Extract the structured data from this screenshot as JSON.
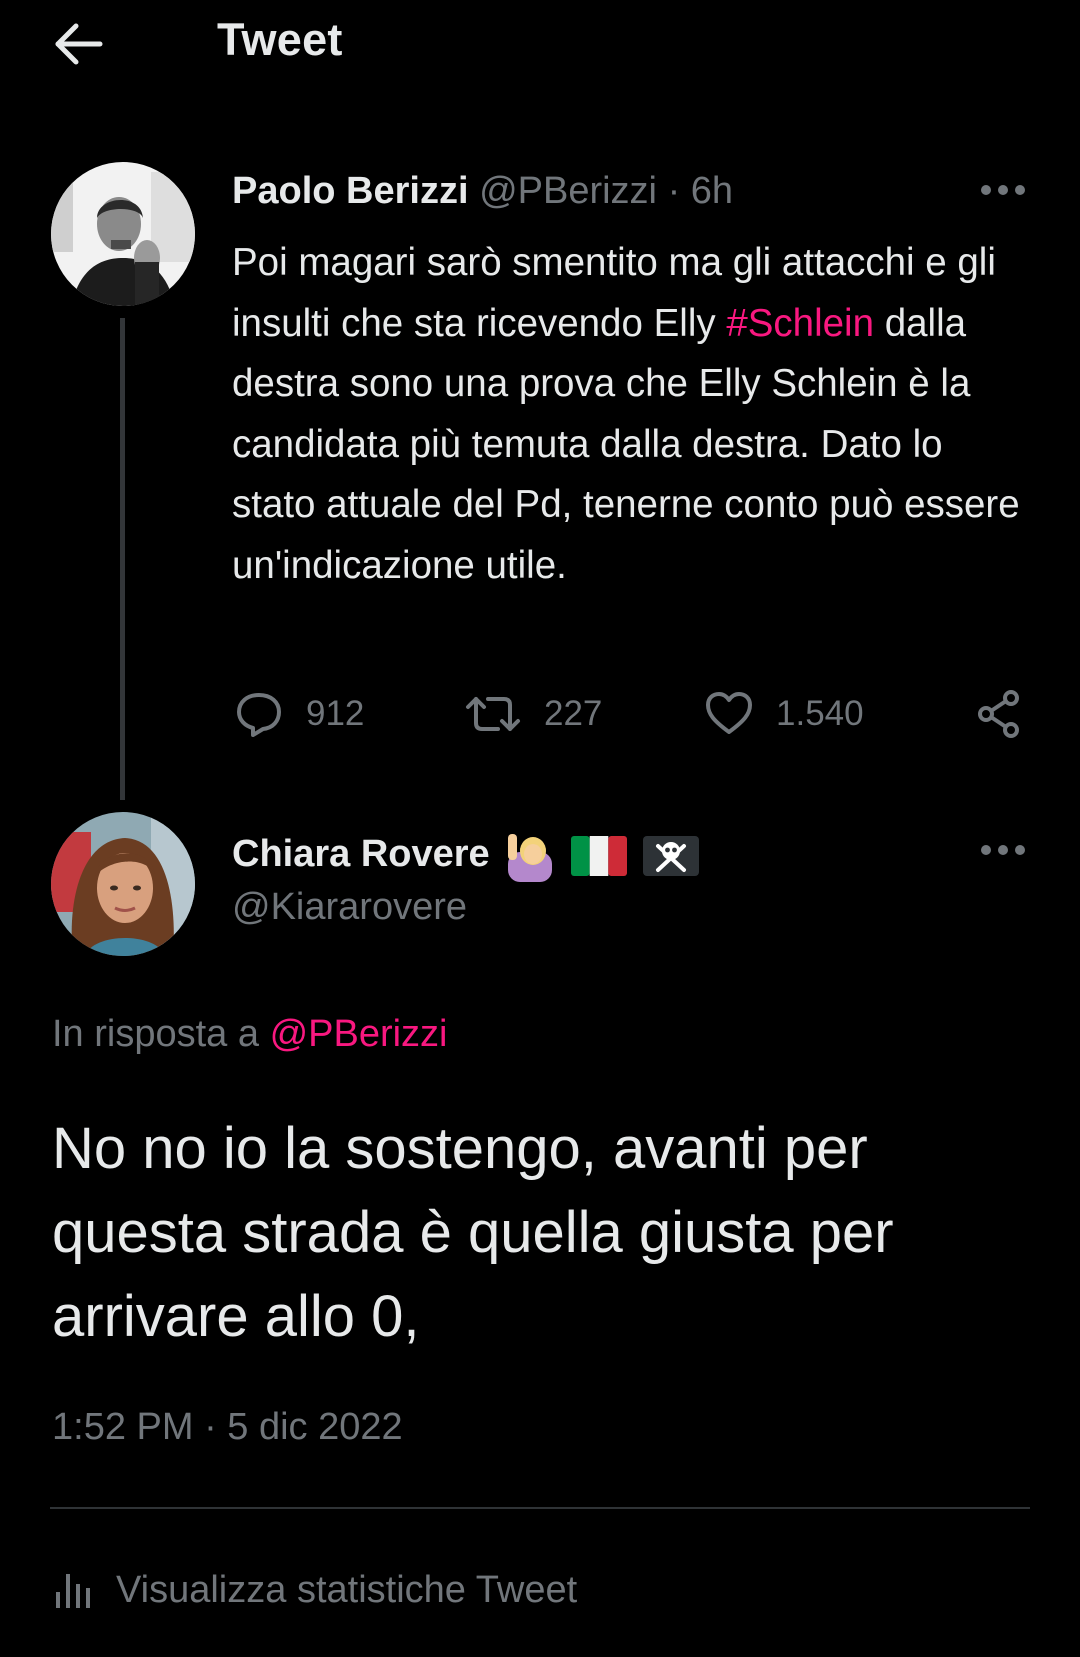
{
  "header": {
    "back_icon": "arrow-left-icon",
    "title": "Tweet"
  },
  "parent_tweet": {
    "display_name": "Paolo Berizzi",
    "handle": "@PBerizzi",
    "separator": " · ",
    "time": "6h",
    "more_icon": "more-horizontal-icon",
    "text_before_hashtag": "Poi magari sarò smentito ma gli attacchi e gli insulti che sta ricevendo Elly ",
    "hashtag": "#Schlein",
    "text_after_hashtag": " dalla destra sono una prova che Elly Schlein è la candidata più temuta dalla destra. Dato lo stato attuale del Pd, tenerne conto può essere un'indicazione utile.",
    "actions": {
      "replies": "912",
      "retweets": "227",
      "likes": "1.540"
    }
  },
  "reply_tweet": {
    "display_name": "Chiara Rovere",
    "name_emojis": [
      "woman-raising-hand-emoji",
      "italy-flag-emoji",
      "pirate-flag-emoji"
    ],
    "handle": "@Kiararovere",
    "reply_to_label": "In risposta a ",
    "reply_to_handle": "@PBerizzi",
    "text": "No no io la sostengo, avanti per questa strada è quella giusta per arrivare allo 0,",
    "timestamp": "1:52 PM · 5 dic 2022"
  },
  "stats": {
    "label": "Visualizza statistiche Tweet"
  },
  "colors": {
    "background": "#000000",
    "primary_text": "#e7e9ea",
    "secondary_text": "#71767b",
    "accent": "#f91880",
    "divider": "#2f3336"
  }
}
